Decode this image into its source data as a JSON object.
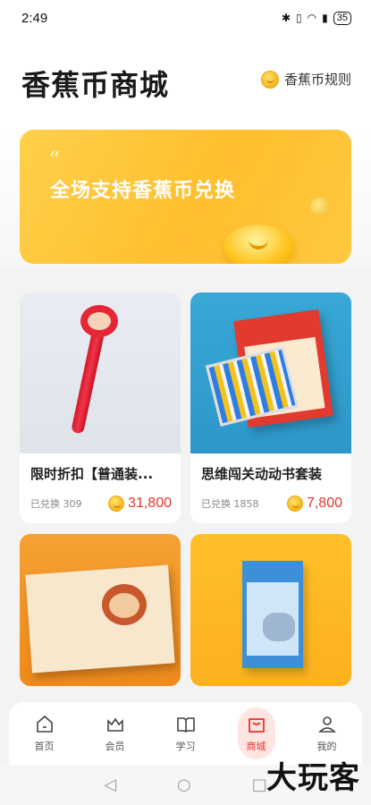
{
  "status_bar": {
    "time": "2:49",
    "battery": "35",
    "icons": [
      "bluetooth-icon",
      "vibrate-icon",
      "wifi-icon",
      "signal-4g-icon"
    ]
  },
  "header": {
    "title": "香蕉币商城",
    "rules_label": "香蕉币规则"
  },
  "banner": {
    "text": "全场支持香蕉币兑换"
  },
  "products": [
    {
      "title": "限时折扣【普通装...",
      "exchanged": "已兑换 309",
      "price": "31,800"
    },
    {
      "title": "思维闯关动动书套装",
      "exchanged": "已兑换 1858",
      "price": "7,800"
    },
    {
      "title": "",
      "exchanged": "",
      "price": ""
    },
    {
      "title": "",
      "exchanged": "",
      "price": ""
    }
  ],
  "tabs": [
    {
      "label": "首页",
      "icon": "home-icon"
    },
    {
      "label": "会员",
      "icon": "crown-icon"
    },
    {
      "label": "学习",
      "icon": "book-icon"
    },
    {
      "label": "商城",
      "icon": "shopping-bag-icon",
      "active": true
    },
    {
      "label": "我的",
      "icon": "person-icon"
    }
  ],
  "watermark": "大玩客",
  "colors": {
    "accent_red": "#e8332a",
    "banner_yellow": "#ffc332",
    "active_tab_bg": "#ffe5e2"
  }
}
